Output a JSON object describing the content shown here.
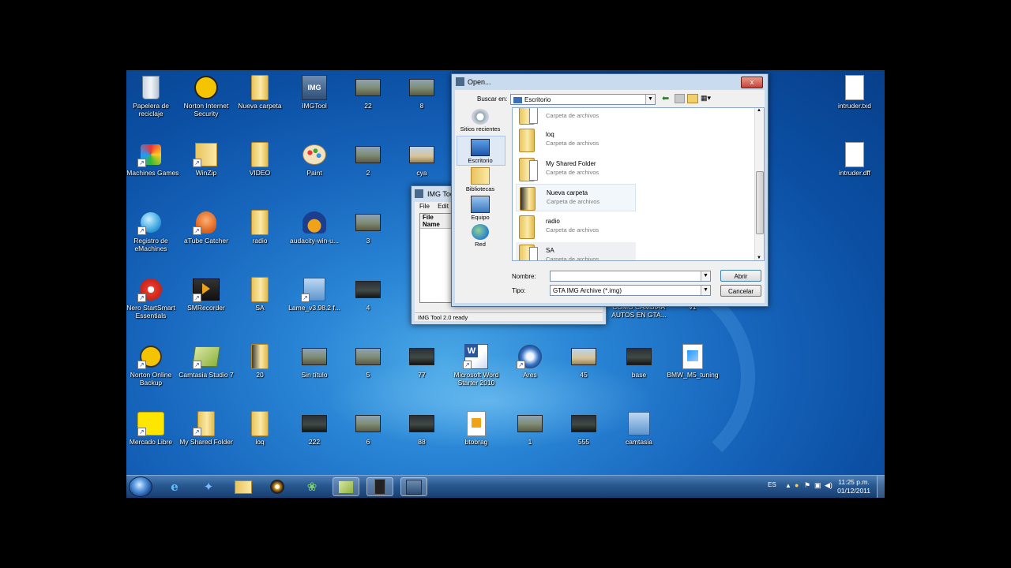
{
  "desktop_icons": [
    {
      "label": "Papelera de reciclaje",
      "icon": "recycle-bin-icon"
    },
    {
      "label": "Norton Internet Security",
      "icon": "norton-icon"
    },
    {
      "label": "Nueva carpeta",
      "icon": "folder-icon"
    },
    {
      "label": "IMGTool",
      "icon": "imgtool-icon"
    },
    {
      "label": "22",
      "icon": "image-thumbnail-icon"
    },
    {
      "label": "8",
      "icon": "image-thumbnail-icon"
    },
    {
      "label": "eMachines Games",
      "icon": "games-icon"
    },
    {
      "label": "WinZip",
      "icon": "winzip-icon"
    },
    {
      "label": "VIDEO",
      "icon": "folder-icon"
    },
    {
      "label": "Paint",
      "icon": "paint-icon"
    },
    {
      "label": "2",
      "icon": "image-thumbnail-icon"
    },
    {
      "label": "cya",
      "icon": "image-thumbnail-icon"
    },
    {
      "label": "Registro de eMachines",
      "icon": "registration-icon"
    },
    {
      "label": "aTube Catcher",
      "icon": "atube-icon"
    },
    {
      "label": "radio",
      "icon": "folder-icon"
    },
    {
      "label": "audacity-win-u...",
      "icon": "audacity-icon"
    },
    {
      "label": "3",
      "icon": "image-thumbnail-icon"
    },
    {
      "label": "Nero StartSmart Essentials",
      "icon": "nero-icon"
    },
    {
      "label": "SMRecorder",
      "icon": "smrecorder-icon"
    },
    {
      "label": "SA",
      "icon": "folder-icon"
    },
    {
      "label": "Lame_v3.98.2 f...",
      "icon": "installer-icon"
    },
    {
      "label": "4",
      "icon": "image-thumbnail-icon"
    },
    {
      "label": "Norton Online Backup",
      "icon": "norton-backup-icon"
    },
    {
      "label": "Camtasia Studio 7",
      "icon": "camtasia-icon"
    },
    {
      "label": "20",
      "icon": "folder-icon"
    },
    {
      "label": "Sin título",
      "icon": "image-thumbnail-icon"
    },
    {
      "label": "5",
      "icon": "image-thumbnail-icon"
    },
    {
      "label": "77",
      "icon": "image-thumbnail-icon"
    },
    {
      "label": "Microsoft Word Starter 2010",
      "icon": "word-icon"
    },
    {
      "label": "Ares",
      "icon": "ares-icon"
    },
    {
      "label": "45",
      "icon": "image-thumbnail-icon"
    },
    {
      "label": "base",
      "icon": "image-thumbnail-icon"
    },
    {
      "label": "BMW_M5_tuning",
      "icon": "document-icon"
    },
    {
      "label": "Mercado Libre",
      "icon": "mercadolibre-icon"
    },
    {
      "label": "My Shared Folder",
      "icon": "folder-icon"
    },
    {
      "label": "loq",
      "icon": "folder-icon"
    },
    {
      "label": "222",
      "icon": "image-thumbnail-icon"
    },
    {
      "label": "6",
      "icon": "image-thumbnail-icon"
    },
    {
      "label": "88",
      "icon": "image-thumbnail-icon"
    },
    {
      "label": "btobrag",
      "icon": "document-icon"
    },
    {
      "label": "1",
      "icon": "image-thumbnail-icon"
    },
    {
      "label": "555",
      "icon": "image-thumbnail-icon"
    },
    {
      "label": "camtasia",
      "icon": "installer-icon"
    },
    {
      "label": "intruder.txd",
      "icon": "file-icon"
    },
    {
      "label": "intruder.dff",
      "icon": "file-icon"
    },
    {
      "label": "COMO CAMBIAR AUTOS EN GTA...",
      "icon": "video-icon"
    },
    {
      "label": "v1",
      "icon": "image-thumbnail-icon"
    }
  ],
  "imgtool": {
    "title": "IMG Too",
    "menu": [
      "File",
      "Edit"
    ],
    "column": "File Name",
    "status": "IMG Tool 2.0 ready"
  },
  "open_dialog": {
    "title": "Open...",
    "lookin_label": "Buscar en:",
    "lookin_value": "Escritorio",
    "places": [
      "Sitios recientes",
      "Escritorio",
      "Bibliotecas",
      "Equipo",
      "Red"
    ],
    "files": [
      {
        "name": "",
        "type": "Carpeta de archivos"
      },
      {
        "name": "loq",
        "type": "Carpeta de archivos"
      },
      {
        "name": "My Shared Folder",
        "type": "Carpeta de archivos"
      },
      {
        "name": "Nueva carpeta",
        "type": "Carpeta de archivos"
      },
      {
        "name": "radio",
        "type": "Carpeta de archivos"
      },
      {
        "name": "SA",
        "type": "Carpeta de archivos"
      }
    ],
    "name_label": "Nombre:",
    "name_value": "",
    "type_label": "Tipo:",
    "type_value": "GTA IMG Archive (*.img)",
    "open_button": "Abrir",
    "cancel_button": "Cancelar",
    "close_glyph": "x"
  },
  "taskbar": {
    "language": "ES",
    "time": "11:25 p.m.",
    "date": "01/12/2011",
    "pinned": [
      "internet-explorer-icon",
      "windows-media-center-icon",
      "windows-explorer-icon",
      "nero-icon",
      "messenger-icon",
      "camtasia-icon",
      "recorder-icon",
      "imgtool-icon"
    ]
  }
}
